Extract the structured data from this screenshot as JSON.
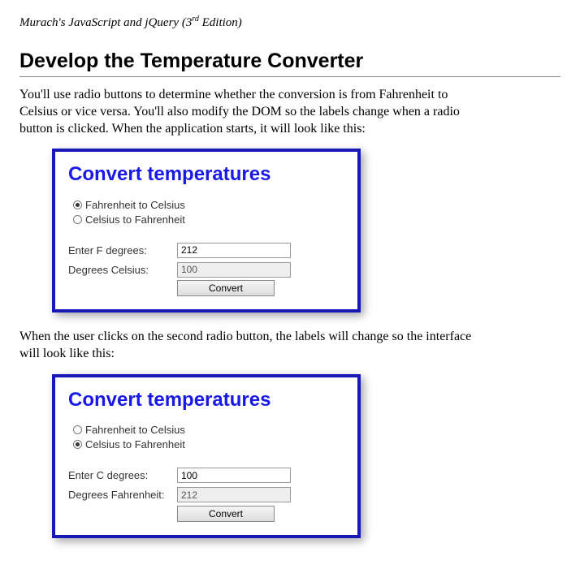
{
  "book_title_html": "Murach's JavaScript and jQuery (3<sup>rd</sup> Edition)",
  "heading": "Develop the Temperature Converter",
  "intro": "You'll use radio buttons to determine whether the conversion is from Fahrenheit to Celsius or vice versa. You'll also modify the DOM so the labels change when a radio button is clicked. When the application starts, it will look like this:",
  "mid_text": "When the user clicks on the second radio button, the labels will change so the interface will look like this:",
  "mock1": {
    "title": "Convert temperatures",
    "radio1": "Fahrenheit to Celsius",
    "radio2": "Celsius to Fahrenheit",
    "label1": "Enter F degrees:",
    "label2": "Degrees Celsius:",
    "input1": "212",
    "input2": "100",
    "button": "Convert"
  },
  "mock2": {
    "title": "Convert temperatures",
    "radio1": "Fahrenheit to Celsius",
    "radio2": "Celsius to Fahrenheit",
    "label1": "Enter C degrees:",
    "label2": "Degrees Fahrenheit:",
    "input1": "100",
    "input2": "212",
    "button": "Convert"
  }
}
